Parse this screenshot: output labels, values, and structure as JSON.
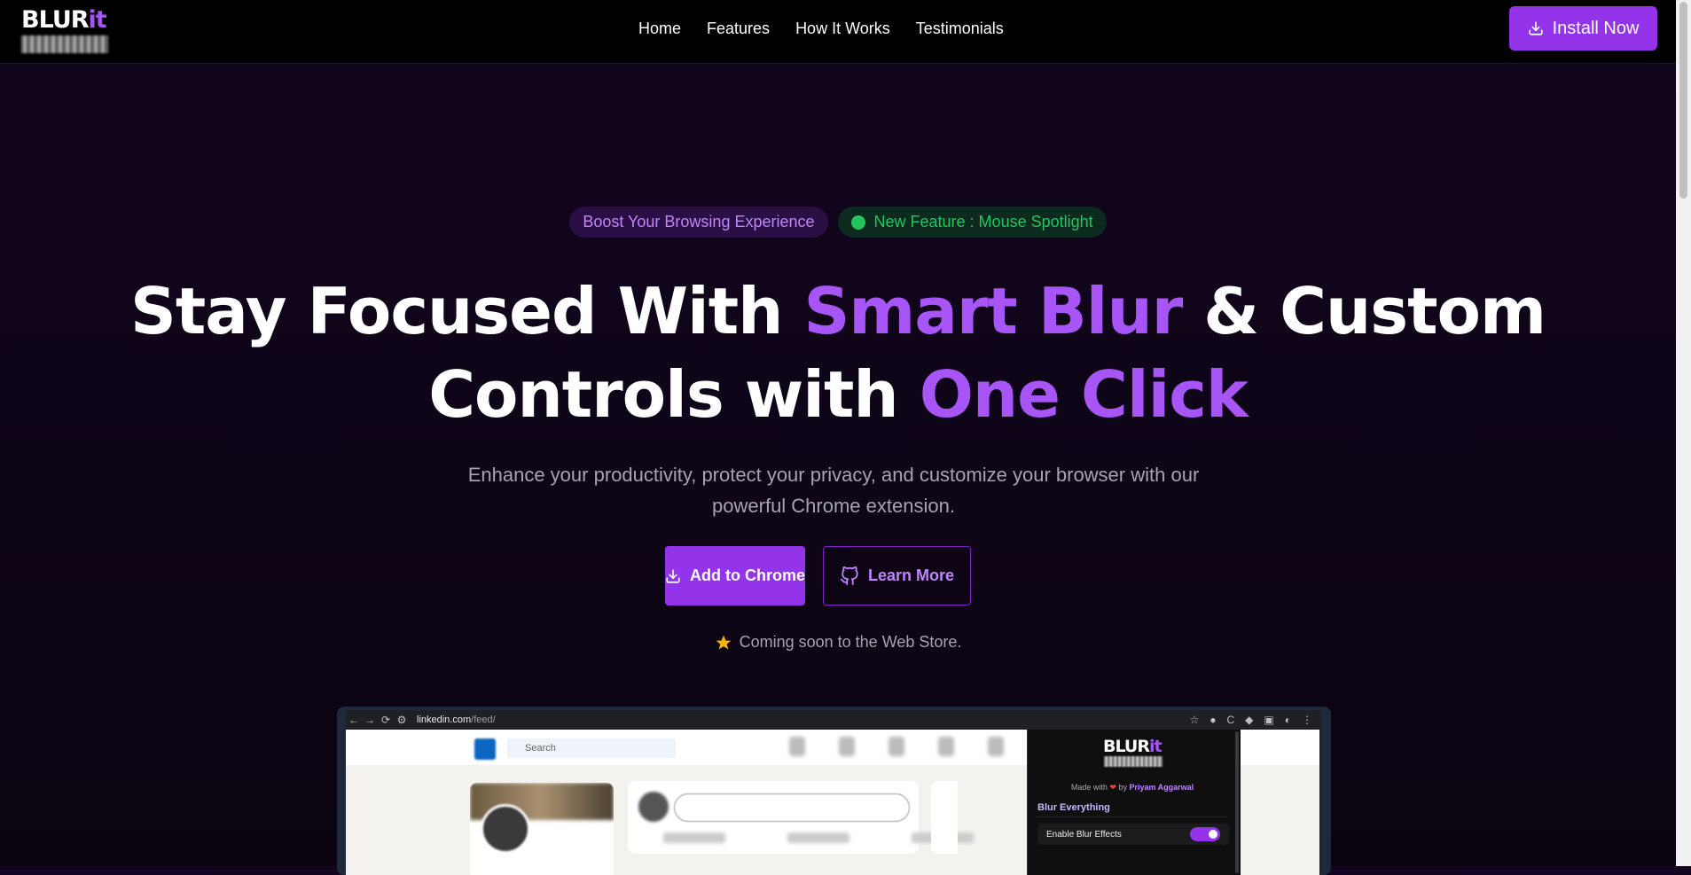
{
  "nav": {
    "logo_main": "BLUR",
    "logo_accent": "it",
    "links": [
      "Home",
      "Features",
      "How It Works",
      "Testimonials"
    ],
    "install_label": "Install Now"
  },
  "hero": {
    "badge_left": "Boost Your Browsing Experience",
    "badge_right": "New Feature : Mouse Spotlight",
    "headline_part1": "Stay Focused With ",
    "headline_accent1": "Smart Blur",
    "headline_part2": " & Custom",
    "headline_part3": "Controls with ",
    "headline_accent2": "One Click",
    "subtitle": "Enhance your productivity, protect your privacy, and customize your browser with our powerful Chrome extension.",
    "primary_cta": "Add to Chrome",
    "secondary_cta": "Learn More",
    "coming_soon": "Coming soon to the Web Store."
  },
  "mockup": {
    "url_host": "linkedin.com",
    "url_path": "/feed/",
    "search_placeholder": "Search",
    "popup": {
      "logo_main": "BLUR",
      "logo_accent": "it",
      "made_with": "Made with",
      "by": "by",
      "author": "Priyam Aggarwal",
      "section_title": "Blur Everything",
      "toggle_label": "Enable Blur Effects",
      "toggle_on": true
    }
  },
  "colors": {
    "accent": "#a855f7",
    "button": "#9333ea",
    "green": "#22c55e"
  }
}
